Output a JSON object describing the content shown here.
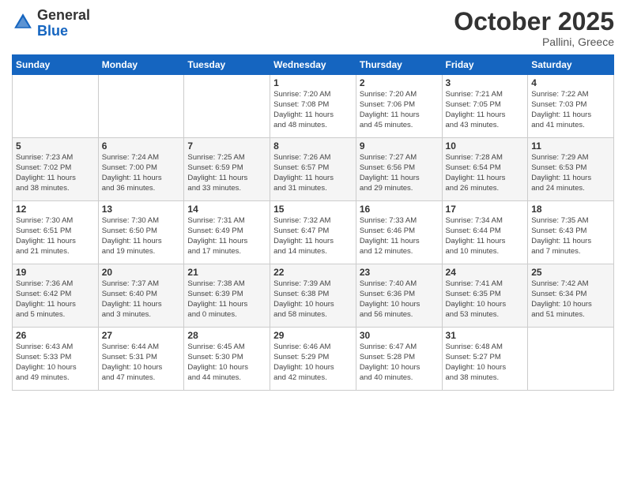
{
  "logo": {
    "general": "General",
    "blue": "Blue"
  },
  "header": {
    "month": "October 2025",
    "location": "Pallini, Greece"
  },
  "weekdays": [
    "Sunday",
    "Monday",
    "Tuesday",
    "Wednesday",
    "Thursday",
    "Friday",
    "Saturday"
  ],
  "weeks": [
    [
      {
        "day": "",
        "info": ""
      },
      {
        "day": "",
        "info": ""
      },
      {
        "day": "",
        "info": ""
      },
      {
        "day": "1",
        "info": "Sunrise: 7:20 AM\nSunset: 7:08 PM\nDaylight: 11 hours\nand 48 minutes."
      },
      {
        "day": "2",
        "info": "Sunrise: 7:20 AM\nSunset: 7:06 PM\nDaylight: 11 hours\nand 45 minutes."
      },
      {
        "day": "3",
        "info": "Sunrise: 7:21 AM\nSunset: 7:05 PM\nDaylight: 11 hours\nand 43 minutes."
      },
      {
        "day": "4",
        "info": "Sunrise: 7:22 AM\nSunset: 7:03 PM\nDaylight: 11 hours\nand 41 minutes."
      }
    ],
    [
      {
        "day": "5",
        "info": "Sunrise: 7:23 AM\nSunset: 7:02 PM\nDaylight: 11 hours\nand 38 minutes."
      },
      {
        "day": "6",
        "info": "Sunrise: 7:24 AM\nSunset: 7:00 PM\nDaylight: 11 hours\nand 36 minutes."
      },
      {
        "day": "7",
        "info": "Sunrise: 7:25 AM\nSunset: 6:59 PM\nDaylight: 11 hours\nand 33 minutes."
      },
      {
        "day": "8",
        "info": "Sunrise: 7:26 AM\nSunset: 6:57 PM\nDaylight: 11 hours\nand 31 minutes."
      },
      {
        "day": "9",
        "info": "Sunrise: 7:27 AM\nSunset: 6:56 PM\nDaylight: 11 hours\nand 29 minutes."
      },
      {
        "day": "10",
        "info": "Sunrise: 7:28 AM\nSunset: 6:54 PM\nDaylight: 11 hours\nand 26 minutes."
      },
      {
        "day": "11",
        "info": "Sunrise: 7:29 AM\nSunset: 6:53 PM\nDaylight: 11 hours\nand 24 minutes."
      }
    ],
    [
      {
        "day": "12",
        "info": "Sunrise: 7:30 AM\nSunset: 6:51 PM\nDaylight: 11 hours\nand 21 minutes."
      },
      {
        "day": "13",
        "info": "Sunrise: 7:30 AM\nSunset: 6:50 PM\nDaylight: 11 hours\nand 19 minutes."
      },
      {
        "day": "14",
        "info": "Sunrise: 7:31 AM\nSunset: 6:49 PM\nDaylight: 11 hours\nand 17 minutes."
      },
      {
        "day": "15",
        "info": "Sunrise: 7:32 AM\nSunset: 6:47 PM\nDaylight: 11 hours\nand 14 minutes."
      },
      {
        "day": "16",
        "info": "Sunrise: 7:33 AM\nSunset: 6:46 PM\nDaylight: 11 hours\nand 12 minutes."
      },
      {
        "day": "17",
        "info": "Sunrise: 7:34 AM\nSunset: 6:44 PM\nDaylight: 11 hours\nand 10 minutes."
      },
      {
        "day": "18",
        "info": "Sunrise: 7:35 AM\nSunset: 6:43 PM\nDaylight: 11 hours\nand 7 minutes."
      }
    ],
    [
      {
        "day": "19",
        "info": "Sunrise: 7:36 AM\nSunset: 6:42 PM\nDaylight: 11 hours\nand 5 minutes."
      },
      {
        "day": "20",
        "info": "Sunrise: 7:37 AM\nSunset: 6:40 PM\nDaylight: 11 hours\nand 3 minutes."
      },
      {
        "day": "21",
        "info": "Sunrise: 7:38 AM\nSunset: 6:39 PM\nDaylight: 11 hours\nand 0 minutes."
      },
      {
        "day": "22",
        "info": "Sunrise: 7:39 AM\nSunset: 6:38 PM\nDaylight: 10 hours\nand 58 minutes."
      },
      {
        "day": "23",
        "info": "Sunrise: 7:40 AM\nSunset: 6:36 PM\nDaylight: 10 hours\nand 56 minutes."
      },
      {
        "day": "24",
        "info": "Sunrise: 7:41 AM\nSunset: 6:35 PM\nDaylight: 10 hours\nand 53 minutes."
      },
      {
        "day": "25",
        "info": "Sunrise: 7:42 AM\nSunset: 6:34 PM\nDaylight: 10 hours\nand 51 minutes."
      }
    ],
    [
      {
        "day": "26",
        "info": "Sunrise: 6:43 AM\nSunset: 5:33 PM\nDaylight: 10 hours\nand 49 minutes."
      },
      {
        "day": "27",
        "info": "Sunrise: 6:44 AM\nSunset: 5:31 PM\nDaylight: 10 hours\nand 47 minutes."
      },
      {
        "day": "28",
        "info": "Sunrise: 6:45 AM\nSunset: 5:30 PM\nDaylight: 10 hours\nand 44 minutes."
      },
      {
        "day": "29",
        "info": "Sunrise: 6:46 AM\nSunset: 5:29 PM\nDaylight: 10 hours\nand 42 minutes."
      },
      {
        "day": "30",
        "info": "Sunrise: 6:47 AM\nSunset: 5:28 PM\nDaylight: 10 hours\nand 40 minutes."
      },
      {
        "day": "31",
        "info": "Sunrise: 6:48 AM\nSunset: 5:27 PM\nDaylight: 10 hours\nand 38 minutes."
      },
      {
        "day": "",
        "info": ""
      }
    ]
  ]
}
